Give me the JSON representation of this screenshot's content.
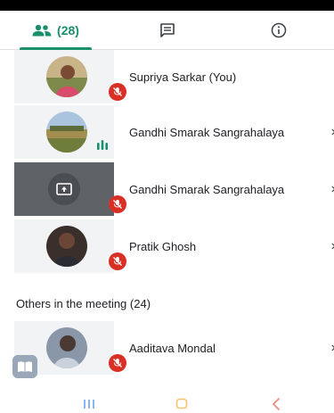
{
  "tabs": {
    "people_count": "(28)"
  },
  "participants": [
    {
      "name": "Supriya Sarkar (You)",
      "muted": true,
      "has_chevron": false
    },
    {
      "name": "Gandhi Smarak Sangrahalaya",
      "muted": false,
      "speaking": true,
      "has_chevron": true
    },
    {
      "name": "Gandhi Smarak Sangrahalaya",
      "muted": true,
      "presenting": true,
      "has_chevron": true
    },
    {
      "name": "Pratik Ghosh",
      "muted": true,
      "has_chevron": true
    }
  ],
  "others_section": {
    "title": "Others in the meeting (24)"
  },
  "others": [
    {
      "name": "Aaditava Mondal",
      "muted": true,
      "has_chevron": true
    }
  ],
  "colors": {
    "accent": "#1a8f6c",
    "mic_off": "#d93025",
    "presenting_bg": "#5f6368"
  },
  "icons": {
    "people_tab": "people-icon",
    "chat_tab": "chat-icon",
    "info_tab": "info-icon"
  },
  "chevron": "›"
}
